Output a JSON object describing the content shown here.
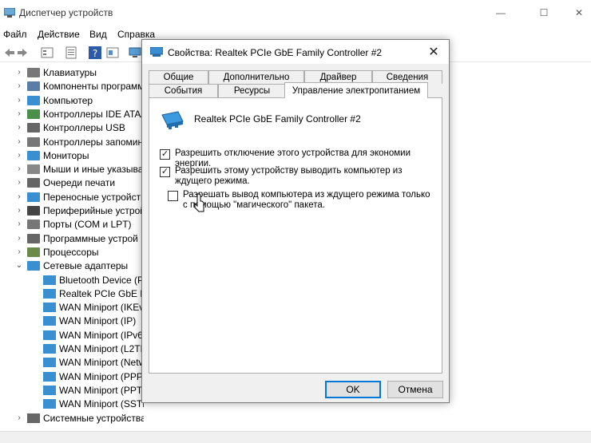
{
  "window": {
    "title": "Диспетчер устройств",
    "minimize_glyph": "—",
    "maximize_glyph": "☐",
    "close_glyph": "✕"
  },
  "menu": {
    "file": "Файл",
    "action": "Действие",
    "view": "Вид",
    "help": "Справка"
  },
  "toolbar": {
    "icons": [
      "back-icon",
      "forward-icon",
      "properties-icon",
      "tree-icon",
      "help-icon",
      "console-icon",
      "monitor-icon"
    ]
  },
  "tree": {
    "items": [
      {
        "label": "Клавиатуры",
        "expanded": false,
        "icon": "keyboard-icon"
      },
      {
        "label": "Компоненты программ",
        "expanded": false,
        "icon": "software-icon"
      },
      {
        "label": "Компьютер",
        "expanded": false,
        "icon": "computer-icon"
      },
      {
        "label": "Контроллеры IDE ATA/A",
        "expanded": false,
        "icon": "ide-icon"
      },
      {
        "label": "Контроллеры USB",
        "expanded": false,
        "icon": "usb-icon"
      },
      {
        "label": "Контроллеры запомин",
        "expanded": false,
        "icon": "storage-icon"
      },
      {
        "label": "Мониторы",
        "expanded": false,
        "icon": "monitor-icon"
      },
      {
        "label": "Мыши и иные указыва",
        "expanded": false,
        "icon": "mouse-icon"
      },
      {
        "label": "Очереди печати",
        "expanded": false,
        "icon": "printer-icon"
      },
      {
        "label": "Переносные устройств",
        "expanded": false,
        "icon": "portable-icon"
      },
      {
        "label": "Периферийные устрой",
        "expanded": false,
        "icon": "gamepad-icon"
      },
      {
        "label": "Порты (COM и LPT)",
        "expanded": false,
        "icon": "port-icon"
      },
      {
        "label": "Программные устрой",
        "expanded": false,
        "icon": "software-device-icon"
      },
      {
        "label": "Процессоры",
        "expanded": false,
        "icon": "cpu-icon"
      },
      {
        "label": "Сетевые адаптеры",
        "expanded": true,
        "icon": "network-icon"
      }
    ],
    "network_children": [
      "Bluetooth Device (Pe",
      "Realtek PCIe GbE Fam",
      "WAN Miniport (IKEv",
      "WAN Miniport (IP)",
      "WAN Miniport (IPv6",
      "WAN Miniport (L2TP",
      "WAN Miniport (Netw",
      "WAN Miniport (PPPO",
      "WAN Miniport (PPTP",
      "WAN Miniport (SSTP)"
    ],
    "last_item": "Системные устройства"
  },
  "dialog": {
    "title": "Свойства: Realtek PCIe GbE Family Controller #2",
    "close_glyph": "✕",
    "tabs_row1": [
      "Общие",
      "Дополнительно",
      "Драйвер",
      "Сведения"
    ],
    "tabs_row2": [
      "События",
      "Ресурсы",
      "Управление электропитанием"
    ],
    "device_name": "Realtek PCIe GbE Family Controller #2",
    "options": [
      {
        "label": "Разрешить отключение этого устройства для экономии энергии.",
        "checked": true
      },
      {
        "label": "Разрешить этому устройству выводить компьютер из ждущего режима.",
        "checked": true
      },
      {
        "label": "Разрешать вывод компьютера из ждущего режима только с помощью \"магического\" пакета.",
        "checked": false
      }
    ],
    "ok_label": "OK",
    "cancel_label": "Отмена",
    "check_glyph": "✓"
  },
  "colors": {
    "accent": "#0078d7",
    "network_icon": "#3a8fd0"
  }
}
